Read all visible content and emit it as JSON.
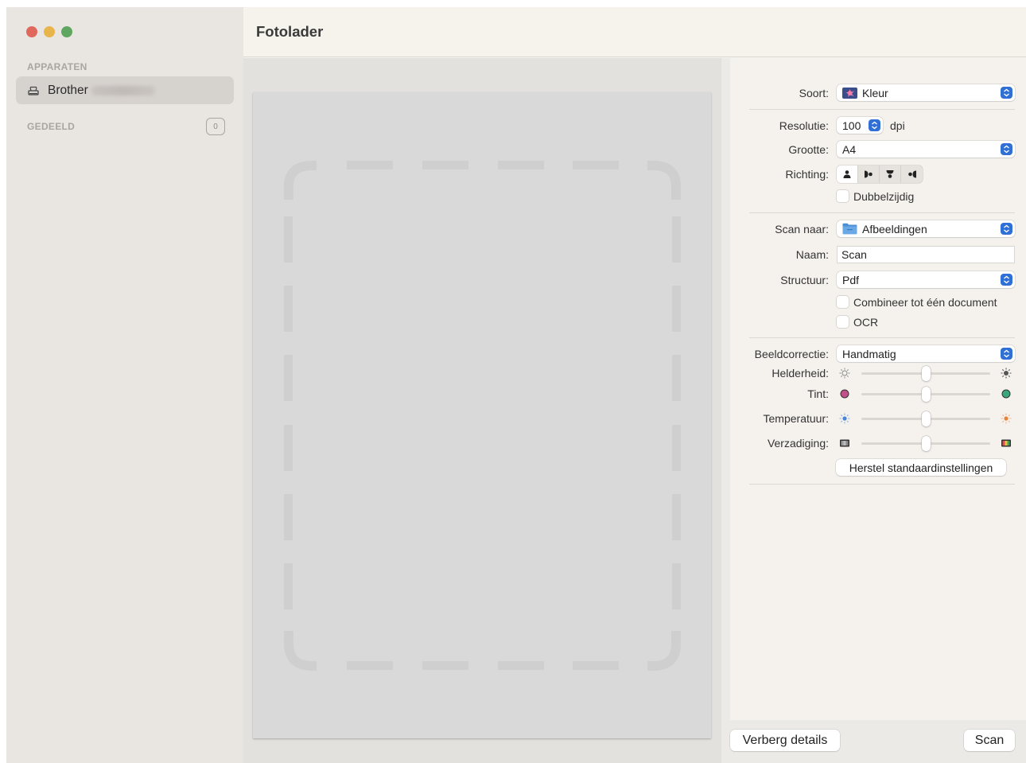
{
  "window": {
    "title": "Fotolader"
  },
  "sidebar": {
    "devices_header": "APPARATEN",
    "shared_header": "GEDEELD",
    "shared_count": "0",
    "devices": [
      {
        "name": "Brother",
        "icon": "scanner-icon",
        "selected": true
      }
    ]
  },
  "details": {
    "kind": {
      "label": "Soort:",
      "value": "Kleur",
      "icon": "color-photo-icon"
    },
    "resolution": {
      "label": "Resolutie:",
      "value": "100",
      "unit": "dpi"
    },
    "size": {
      "label": "Grootte:",
      "value": "A4"
    },
    "orientation": {
      "label": "Richting:",
      "options": [
        "portrait-up-icon",
        "rotate-left-icon",
        "upside-down-icon",
        "rotate-right-icon"
      ],
      "selected_index": 0
    },
    "duplex": {
      "label": "Dubbelzijdig",
      "checked": false
    },
    "scan_to": {
      "label": "Scan naar:",
      "value": "Afbeeldingen",
      "icon": "folder-icon"
    },
    "name": {
      "label": "Naam:",
      "value": "Scan"
    },
    "format": {
      "label": "Structuur:",
      "value": "Pdf"
    },
    "combine": {
      "label": "Combineer tot één document",
      "checked": false
    },
    "ocr": {
      "label": "OCR",
      "checked": false
    },
    "correction": {
      "label": "Beeldcorrectie:",
      "value": "Handmatig"
    },
    "brightness": {
      "label": "Helderheid:",
      "value": 0.5
    },
    "tint": {
      "label": "Tint:",
      "value": 0.5,
      "left_color": "#c2508a",
      "right_color": "#3aa77a"
    },
    "temperature": {
      "label": "Temperatuur:",
      "value": 0.5
    },
    "saturation": {
      "label": "Verzadiging:",
      "value": 0.5
    },
    "reset_label": "Herstel standaardinstellingen"
  },
  "footer": {
    "hide_details_label": "Verberg details",
    "scan_label": "Scan"
  },
  "colors": {
    "accent": "#2f6fd6",
    "sidebar_bg": "#e9e6e2",
    "selected_item_bg": "#d6d2ce"
  }
}
